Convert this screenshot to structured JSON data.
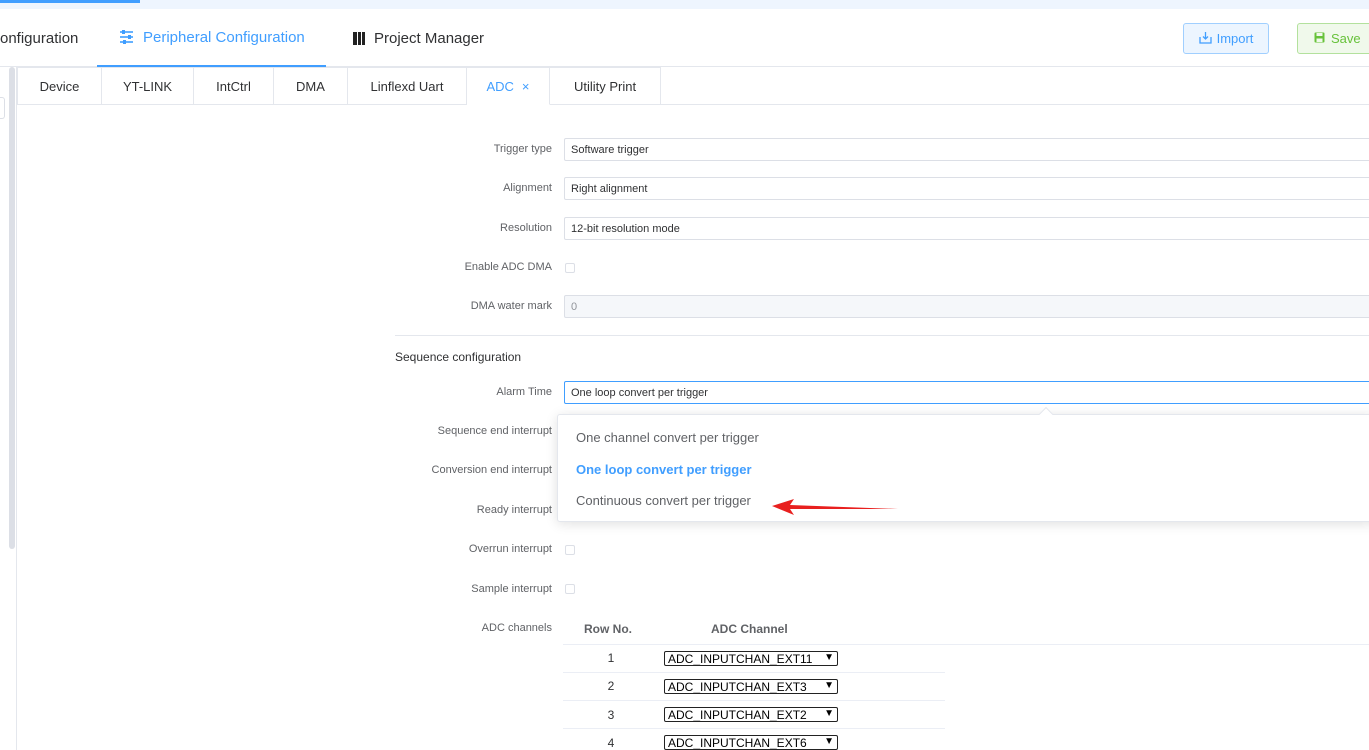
{
  "header": {
    "nav": [
      {
        "label": "onfiguration"
      },
      {
        "label": "Peripheral Configuration"
      },
      {
        "label": "Project Manager"
      }
    ],
    "import_label": "Import",
    "save_label": "Save"
  },
  "tabs": [
    {
      "label": "Device"
    },
    {
      "label": "YT-LINK"
    },
    {
      "label": "IntCtrl"
    },
    {
      "label": "DMA"
    },
    {
      "label": "Linflexd Uart"
    },
    {
      "label": "ADC",
      "close": "×"
    },
    {
      "label": "Utility Print"
    }
  ],
  "form": {
    "trigger_type": {
      "label": "Trigger type",
      "value": "Software trigger"
    },
    "alignment": {
      "label": "Alignment",
      "value": "Right alignment"
    },
    "resolution": {
      "label": "Resolution",
      "value": "12-bit resolution mode"
    },
    "enable_dma": {
      "label": "Enable ADC DMA",
      "checked": false
    },
    "dma_watermark": {
      "label": "DMA water mark",
      "value": "0"
    }
  },
  "sequence": {
    "title": "Sequence configuration",
    "alarm_time": {
      "label": "Alarm Time",
      "value": "One loop convert per trigger"
    },
    "seq_end_interrupt": {
      "label": "Sequence end interrupt"
    },
    "conv_end_interrupt": {
      "label": "Conversion end interrupt"
    },
    "ready_interrupt": {
      "label": "Ready interrupt"
    },
    "overrun_interrupt": {
      "label": "Overrun interrupt",
      "checked": false
    },
    "sample_interrupt": {
      "label": "Sample interrupt",
      "checked": false
    },
    "adc_channels_label": "ADC channels"
  },
  "dropdown": {
    "options": [
      {
        "label": "One channel convert per trigger",
        "selected": false
      },
      {
        "label": "One loop convert per trigger",
        "selected": true
      },
      {
        "label": "Continuous convert per trigger",
        "selected": false
      }
    ]
  },
  "channels_table": {
    "headers": [
      "Row No.",
      "ADC Channel"
    ],
    "rows": [
      {
        "no": "1",
        "channel": "ADC_INPUTCHAN_EXT11"
      },
      {
        "no": "2",
        "channel": "ADC_INPUTCHAN_EXT3"
      },
      {
        "no": "3",
        "channel": "ADC_INPUTCHAN_EXT2"
      },
      {
        "no": "4",
        "channel": "ADC_INPUTCHAN_EXT6"
      }
    ]
  },
  "colors": {
    "accent": "#409eff",
    "save": "#67c23a",
    "annotation_arrow": "#e8201f"
  }
}
